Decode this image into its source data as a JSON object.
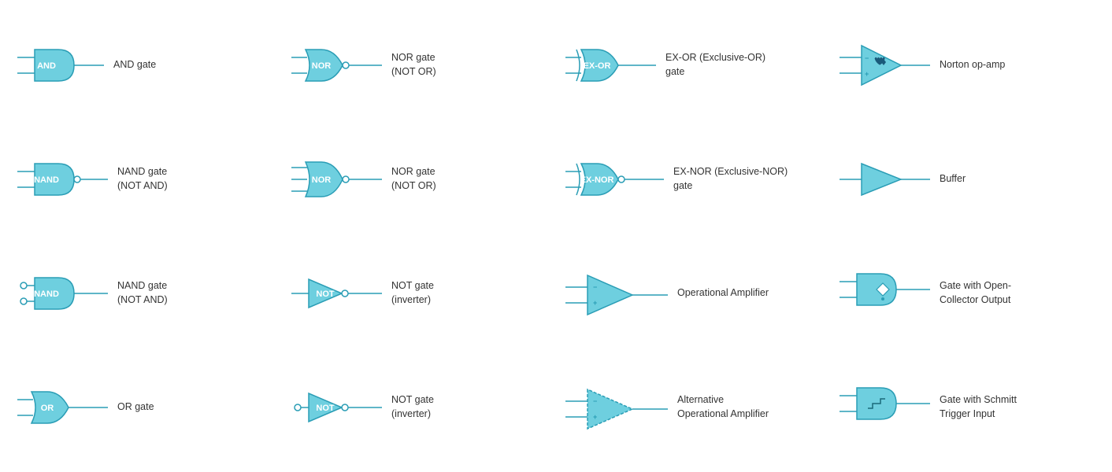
{
  "cells": [
    {
      "id": "and-gate",
      "label": "AND gate",
      "type": "and"
    },
    {
      "id": "nor-gate-1",
      "label": "NOR gate\n(NOT OR)",
      "type": "nor"
    },
    {
      "id": "exor-gate",
      "label": "EX-OR (Exclusive-OR)\ngate",
      "type": "exor"
    },
    {
      "id": "norton-opamp",
      "label": "Norton op-amp",
      "type": "norton"
    },
    {
      "id": "nand-gate-1",
      "label": "NAND gate\n(NOT AND)",
      "type": "nand"
    },
    {
      "id": "nor-gate-2",
      "label": "NOR gate\n(NOT OR)",
      "type": "nor2"
    },
    {
      "id": "exnor-gate",
      "label": "EX-NOR (Exclusive-NOR)\ngate",
      "type": "exnor"
    },
    {
      "id": "buffer",
      "label": "Buffer",
      "type": "buffer"
    },
    {
      "id": "nand-gate-2",
      "label": "NAND gate\n(NOT AND)",
      "type": "nand2"
    },
    {
      "id": "not-gate-1",
      "label": "NOT gate\n(inverter)",
      "type": "not1"
    },
    {
      "id": "opamp",
      "label": "Operational Amplifier",
      "type": "opamp"
    },
    {
      "id": "open-collector",
      "label": "Gate with Open-\nCollector Output",
      "type": "opencollector"
    },
    {
      "id": "or-gate",
      "label": "OR gate",
      "type": "or"
    },
    {
      "id": "not-gate-2",
      "label": "NOT gate\n(inverter)",
      "type": "not2"
    },
    {
      "id": "alt-opamp",
      "label": "Alternative\nOperational Amplifier",
      "type": "altopamp"
    },
    {
      "id": "schmitt",
      "label": "Gate with Schmitt\nTrigger Input",
      "type": "schmitt"
    }
  ]
}
